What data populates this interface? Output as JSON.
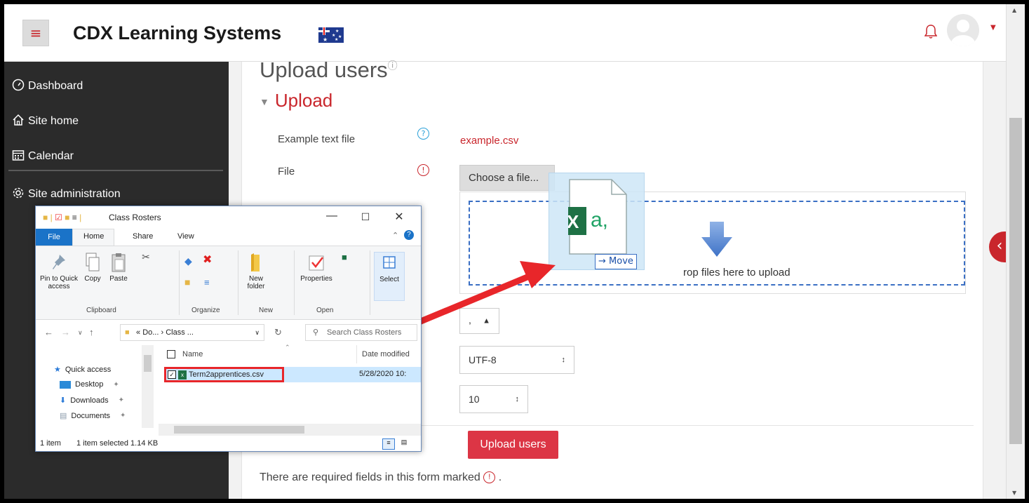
{
  "navbar": {
    "brand": "CDX Learning Systems"
  },
  "sidebar": {
    "items": [
      {
        "label": "Dashboard"
      },
      {
        "label": "Site home"
      },
      {
        "label": "Calendar"
      },
      {
        "label": "Site administration"
      }
    ]
  },
  "main": {
    "page_title": "Upload users",
    "section": "Upload",
    "example_label": "Example text file",
    "example_link": "example.csv",
    "file_label": "File",
    "choose_button": "Choose a file...",
    "drop_text": "rop files here to upload",
    "delimiter_value": ",",
    "encoding_value": "UTF-8",
    "preview_rows_value": "10",
    "upload_button": "Upload users",
    "required_note": "There are required fields in this form marked",
    "required_note_end": "."
  },
  "drag": {
    "move_label": "Move"
  },
  "explorer": {
    "title": "Class Rosters",
    "menu": [
      "File",
      "Home",
      "Share",
      "View"
    ],
    "ribbon": {
      "pin": "Pin to Quick access",
      "copy": "Copy",
      "paste": "Paste",
      "new_folder": "New folder",
      "properties": "Properties",
      "select": "Select",
      "groups": [
        "Clipboard",
        "Organize",
        "New",
        "Open"
      ]
    },
    "address": {
      "path_root": "«",
      "path_1": "Do...",
      "path_sep": "›",
      "path_2": "Class ...",
      "search_placeholder": "Search Class Rosters"
    },
    "nav": [
      "Quick access",
      "Desktop",
      "Downloads",
      "Documents"
    ],
    "columns": {
      "name": "Name",
      "date": "Date modified"
    },
    "file": {
      "name": "Term2apprentices.csv",
      "date": "5/28/2020 10:"
    },
    "status": {
      "count": "1 item",
      "selected": "1 item selected  1.14 KB"
    }
  },
  "colors": {
    "brand_red": "#c9262c",
    "sidebar_bg": "#2b2b2b",
    "upload_button": "#dc3545",
    "dropzone_border": "#3a6fc4",
    "annotation_red": "#e8262a",
    "explorer_file_tab": "#1a73c8"
  },
  "icons": {
    "dashboard": "gauge-icon",
    "site_home": "home-icon",
    "calendar": "calendar-icon",
    "site_admin": "gear-icon",
    "notifications": "bell-icon",
    "drawer": "chevron-left-icon"
  }
}
